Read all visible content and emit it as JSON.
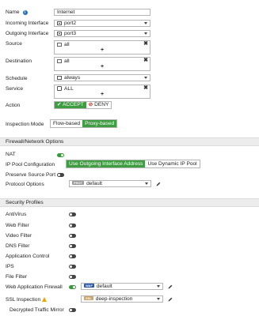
{
  "general": {
    "name_label": "Name",
    "name_value": "Internet",
    "incoming_label": "Incoming Interface",
    "incoming_value": "port2",
    "outgoing_label": "Outgoing Interface",
    "outgoing_value": "port3",
    "source_label": "Source",
    "source_value": "all",
    "destination_label": "Destination",
    "destination_value": "all",
    "schedule_label": "Schedule",
    "schedule_value": "always",
    "service_label": "Service",
    "service_value": "ALL",
    "action_label": "Action",
    "accept_label": "ACCEPT",
    "deny_label": "DENY",
    "inspection_label": "Inspection Mode",
    "flow_label": "Flow-based",
    "proxy_label": "Proxy-based",
    "plus_symbol": "+",
    "remove_symbol": "✖"
  },
  "firewall_network": {
    "title": "Firewall/Network Options",
    "nat_label": "NAT",
    "nat_enabled": true,
    "ippool_label": "IP Pool Configuration",
    "ippool_opt1": "Use Outgoing Interface Address",
    "ippool_opt2": "Use Dynamic IP Pool",
    "preserve_label": "Preserve Source Port",
    "preserve_enabled": false,
    "protocol_label": "Protocol Options",
    "protocol_badge": "PROT",
    "protocol_value": "default"
  },
  "security_profiles": {
    "title": "Security Profiles",
    "items": [
      {
        "label": "AntiVirus",
        "enabled": false
      },
      {
        "label": "Web Filter",
        "enabled": false
      },
      {
        "label": "Video Filter",
        "enabled": false
      },
      {
        "label": "DNS Filter",
        "enabled": false
      },
      {
        "label": "Application Control",
        "enabled": false
      },
      {
        "label": "IPS",
        "enabled": false
      },
      {
        "label": "File Filter",
        "enabled": false
      }
    ],
    "waf_label": "Web Application Firewall",
    "waf_enabled": true,
    "waf_badge": "WAF",
    "waf_value": "default",
    "ssl_label": "SSL Inspection",
    "ssl_badge": "SSL",
    "ssl_value": "deep-inspection",
    "decrypted_label": "Decrypted Traffic Mirror",
    "decrypted_enabled": false
  },
  "colors": {
    "accent_green": "#3e9d41",
    "deny_red": "#d0302a",
    "info_blue": "#2a6db5",
    "warning_yellow": "#e8a800",
    "section_bg": "#ececec"
  }
}
